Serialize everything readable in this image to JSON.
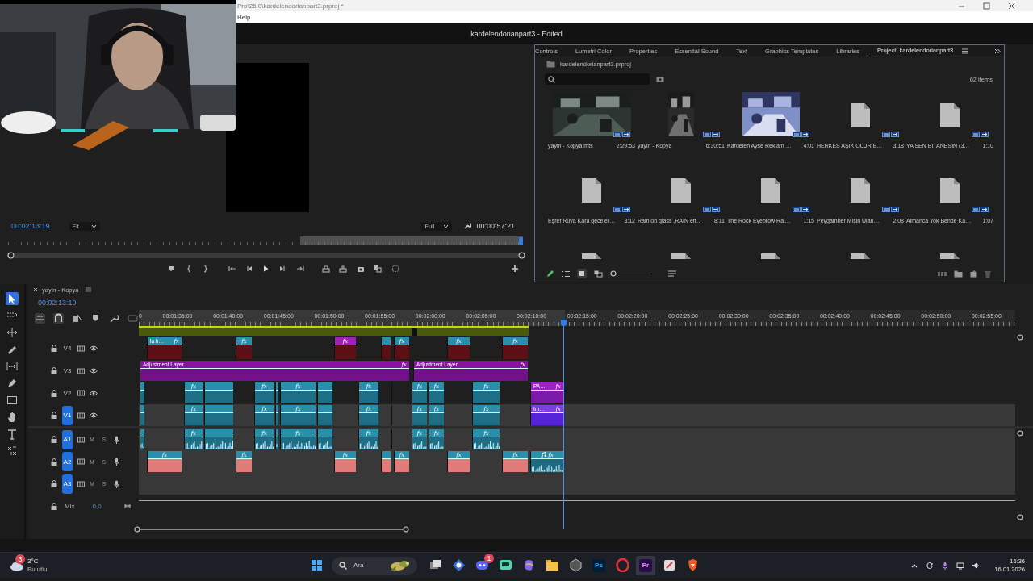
{
  "window": {
    "path": "Pro\\25.0\\kardelendorianpart3.prproj *",
    "menu": [
      "Help"
    ],
    "title": "kardelendorianpart3 - Edited"
  },
  "monitor": {
    "timecode": "00:02:13:19",
    "zoom": "Fit",
    "quality": "Full",
    "duration": "00:00:57:21"
  },
  "panel_tabs": [
    {
      "label": "Controls",
      "selected": false
    },
    {
      "label": "Lumetri Color",
      "selected": false
    },
    {
      "label": "Properties",
      "selected": false
    },
    {
      "label": "Essential Sound",
      "selected": false
    },
    {
      "label": "Text",
      "selected": false
    },
    {
      "label": "Graphics Templates",
      "selected": false
    },
    {
      "label": "Libraries",
      "selected": false
    },
    {
      "label": "Project: kardelendorianpart3",
      "selected": true
    }
  ],
  "project": {
    "file": "kardelendorianpart3.prproj",
    "count": "62 items",
    "items": [
      {
        "kind": "video",
        "name": "yayin - Kopya.mts",
        "duration": "2:29:53"
      },
      {
        "kind": "portrait",
        "name": "yayin - Kopya",
        "duration": "6:30:51"
      },
      {
        "kind": "classroom",
        "name": "Kardelen Ayse Reklam …",
        "duration": "4:01"
      },
      {
        "kind": "file",
        "name": "HERKES AŞIK OLUR B…",
        "duration": "3:18"
      },
      {
        "kind": "file",
        "name": "YA SEN BITANESIN (3…",
        "duration": "1:10"
      },
      {
        "kind": "file",
        "name": "Eşref Rüya Kara geceler…",
        "duration": "3:12"
      },
      {
        "kind": "file",
        "name": "Rain on glass ,RAIN eff…",
        "duration": "8:11"
      },
      {
        "kind": "file",
        "name": "The Rock Eyebrow Rai…",
        "duration": "1:15"
      },
      {
        "kind": "file",
        "name": "Peygamber Misin Ulan…",
        "duration": "2:08"
      },
      {
        "kind": "file",
        "name": "Almanca Yok Bende Ka…",
        "duration": "1:07"
      },
      {
        "kind": "file"
      },
      {
        "kind": "file"
      },
      {
        "kind": "file"
      },
      {
        "kind": "file"
      },
      {
        "kind": "file"
      }
    ]
  },
  "timeline": {
    "sequence": "yayin - Kopya",
    "timecode": "00:02:13:19",
    "ruler": [
      "0",
      "00:01:35:00",
      "00:01:40:00",
      "00:01:45:00",
      "00:01:50:00",
      "00:01:55:00",
      "00:02:00:00",
      "00:02:05:00",
      "00:02:10:00",
      "00:02:15:00",
      "00:02:20:00",
      "00:02:25:00",
      "00:02:30:00",
      "00:02:35:00",
      "00:02:40:00",
      "00:02:45:00",
      "00:02:50:00",
      "00:02:55:00"
    ],
    "tools": [
      {
        "kind": "select",
        "selected": true
      },
      {
        "kind": "track-select",
        "selected": false
      },
      {
        "kind": "ripple",
        "selected": false
      },
      {
        "kind": "razor",
        "selected": false
      },
      {
        "kind": "slip",
        "selected": false
      },
      {
        "kind": "pen",
        "selected": false
      },
      {
        "kind": "rectangle",
        "selected": false
      },
      {
        "kind": "hand",
        "selected": false
      },
      {
        "kind": "type",
        "selected": false
      },
      {
        "kind": "remix",
        "selected": false
      }
    ],
    "tracks": [
      {
        "name": "V4",
        "kind": "video",
        "targeted": false,
        "clips": [
          {
            "kind": "still",
            "label": "la h…",
            "effect": "fx"
          },
          {
            "kind": "still",
            "effect": "fx"
          },
          {
            "kind": "graphic",
            "effect": "fx"
          },
          {
            "kind": "still"
          },
          {
            "kind": "still",
            "effect": "fx"
          },
          {
            "kind": "still",
            "effect": "fx"
          },
          {
            "kind": "still",
            "effect": "fx"
          }
        ]
      },
      {
        "name": "V3",
        "kind": "video",
        "targeted": false,
        "clips": [
          {
            "kind": "adjustment",
            "label": "Adjustment Layer",
            "effect": "fx"
          },
          {
            "kind": "adjustment",
            "label": "Adjustment Layer",
            "effect": "fx"
          }
        ]
      },
      {
        "name": "V2",
        "kind": "video",
        "targeted": false,
        "clips": [
          {
            "kind": "video"
          },
          {
            "kind": "video",
            "effect": "fx"
          },
          {
            "kind": "video"
          },
          {
            "kind": "video",
            "effect": "fx"
          },
          {
            "kind": "video"
          },
          {
            "kind": "video",
            "effect": "fx"
          },
          {
            "kind": "video"
          },
          {
            "kind": "video",
            "effect": "fx"
          },
          {
            "kind": "video"
          },
          {
            "kind": "video",
            "effect": "fx"
          },
          {
            "kind": "video",
            "effect": "fx"
          },
          {
            "kind": "video",
            "effect": "fx"
          },
          {
            "kind": "nested",
            "label": "PA…",
            "effect": "fx"
          }
        ]
      },
      {
        "name": "V1",
        "kind": "video",
        "targeted": true,
        "clips": [
          {
            "kind": "video"
          },
          {
            "kind": "video",
            "effect": "fx"
          },
          {
            "kind": "video"
          },
          {
            "kind": "video",
            "effect": "fx"
          },
          {
            "kind": "video"
          },
          {
            "kind": "video",
            "effect": "fx"
          },
          {
            "kind": "video"
          },
          {
            "kind": "video",
            "effect": "fx"
          },
          {
            "kind": "video"
          },
          {
            "kind": "video",
            "effect": "fx"
          },
          {
            "kind": "video",
            "effect": "fx"
          },
          {
            "kind": "video",
            "effect": "fx"
          },
          {
            "label": "Im…",
            "effect": "fx"
          }
        ]
      },
      {
        "name": "A1",
        "kind": "audio",
        "targeted": true,
        "mute": "M",
        "solo": "S",
        "clips": [
          {
            "kind": "audio"
          },
          {
            "kind": "audio",
            "effect": "fx"
          },
          {
            "kind": "audio"
          },
          {
            "kind": "audio",
            "effect": "fx"
          },
          {
            "kind": "audio"
          },
          {
            "kind": "audio",
            "effect": "fx"
          },
          {
            "kind": "audio"
          },
          {
            "kind": "audio",
            "effect": "fx"
          },
          {
            "kind": "audio"
          },
          {
            "kind": "audio",
            "effect": "fx"
          },
          {
            "kind": "audio",
            "effect": "fx"
          },
          {
            "kind": "audio",
            "effect": "fx"
          }
        ]
      },
      {
        "name": "A2",
        "kind": "audio",
        "targeted": true,
        "mute": "M",
        "solo": "S",
        "clips": [
          {
            "kind": "sfx",
            "effect": "fx"
          },
          {
            "kind": "sfx",
            "effect": "fx"
          },
          {
            "kind": "sfx",
            "effect": "fx"
          },
          {
            "kind": "sfx"
          },
          {
            "kind": "sfx",
            "effect": "fx"
          },
          {
            "kind": "sfx",
            "effect": "fx"
          },
          {
            "kind": "sfx",
            "effect": "fx"
          },
          {
            "kind": "music",
            "effect": "fx"
          }
        ]
      },
      {
        "name": "A3",
        "kind": "audio",
        "targeted": true,
        "mute": "M",
        "solo": "S"
      }
    ],
    "mix": {
      "label": "Mix",
      "value": "0,0"
    }
  },
  "taskbar": {
    "weather": {
      "badge": "3",
      "temperature": "3°C",
      "condition": "Bulutlu"
    },
    "search": {
      "placeholder": "Ara"
    },
    "apps": [
      {
        "kind": "start",
        "selected": false
      },
      {
        "kind": "task-view",
        "selected": false
      },
      {
        "kind": "snip",
        "selected": false
      },
      {
        "kind": "discord",
        "badge": "1",
        "selected": false
      },
      {
        "kind": "chat",
        "selected": false
      },
      {
        "kind": "copilot",
        "selected": false
      },
      {
        "kind": "folder",
        "selected": false
      },
      {
        "kind": "cube",
        "selected": false
      },
      {
        "kind": "ps",
        "label": "Ps",
        "selected": false
      },
      {
        "kind": "opera",
        "selected": false
      },
      {
        "kind": "pr",
        "label": "Pr",
        "selected": true
      },
      {
        "kind": "tool",
        "selected": false
      },
      {
        "kind": "brave",
        "selected": false
      }
    ],
    "clock": {
      "time": "16:36",
      "date": "16.01.2026"
    }
  }
}
